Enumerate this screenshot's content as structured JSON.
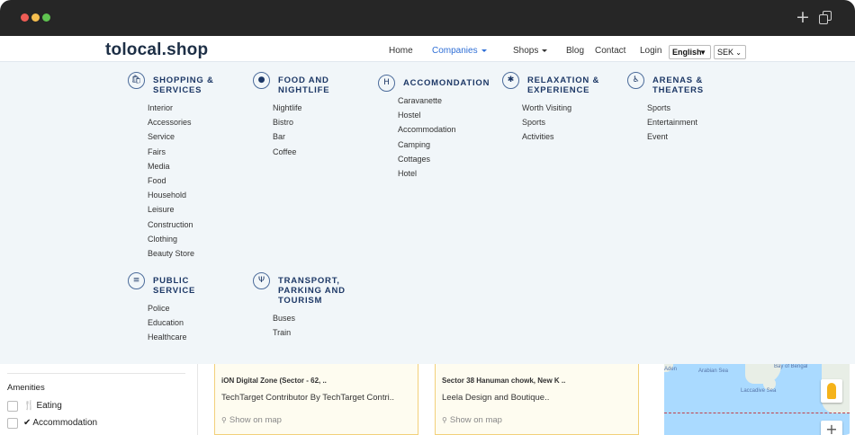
{
  "titlebar": {
    "plus_glyph": "+"
  },
  "header": {
    "logo": "tolocal.shop",
    "nav": {
      "home": "Home",
      "companies": "Companies",
      "shops": "Shops",
      "blog": "Blog",
      "contact": "Contact",
      "login": "Login"
    },
    "language": "English",
    "currency": "SEK"
  },
  "mega_menu": {
    "categories": [
      {
        "icon": "shopping-bag-icon",
        "icon_glyph": "🛍",
        "title": "SHOPPING & SERVICES",
        "title_lines": [
          "SHOPPING &",
          "SERVICES"
        ],
        "items": [
          "Interior",
          "Accessories",
          "Service",
          "Fairs",
          "Media",
          "Food",
          "Household",
          "Leisure",
          "Construction",
          "Clothing",
          "Beauty Store"
        ]
      },
      {
        "icon": "globe-icon",
        "icon_glyph": "●",
        "title": "FOOD AND NIGHTLIFE",
        "title_lines": [
          "FOOD AND",
          "NIGHTLIFE"
        ],
        "items": [
          "Nightlife",
          "Bistro",
          "Bar",
          "Coffee"
        ]
      },
      {
        "icon": "hotel-icon",
        "icon_glyph": "H",
        "title": "ACCOMONDATION",
        "title_lines": [
          "ACCOMONDATION"
        ],
        "items": [
          "Caravanette",
          "Hostel",
          "Accommodation",
          "Camping",
          "Cottages",
          "Hotel"
        ]
      },
      {
        "icon": "bug-icon",
        "icon_glyph": "✱",
        "title": "RELAXATION & EXPERIENCE",
        "title_lines": [
          "RELAXATION &",
          "EXPERIENCE"
        ],
        "items": [
          "Worth Visiting",
          "Sports",
          "Activities"
        ]
      },
      {
        "icon": "wheelchair-icon",
        "icon_glyph": "♿",
        "title": "ARENAS & THEATERS",
        "title_lines": [
          "ARENAS &",
          "THEATERS"
        ],
        "items": [
          "Sports",
          "Entertainment",
          "Event"
        ]
      },
      {
        "icon": "building-icon",
        "icon_glyph": "≡",
        "title": "PUBLIC SERVICE",
        "title_lines": [
          "PUBLIC",
          "SERVICE"
        ],
        "items": [
          "Police",
          "Education",
          "Healthcare"
        ]
      },
      {
        "icon": "utensils-icon",
        "icon_glyph": "Ψ",
        "title": "TRANSPORT, PARKING AND TOURISM",
        "title_lines": [
          "TRANSPORT,",
          "PARKING AND",
          "TOURISM"
        ],
        "items": [
          "Buses",
          "Train"
        ]
      }
    ]
  },
  "sidebar": {
    "amenities_title": "Amenities",
    "amenities": [
      {
        "label": "Eating",
        "icon": "utensils-icon",
        "icon_glyph": "🍴"
      },
      {
        "label": "Accommodation",
        "icon": "check-icon",
        "icon_glyph": "✔"
      }
    ]
  },
  "listings": [
    {
      "address": "iON Digital Zone (Sector - 62, ..",
      "name": "TechTarget Contributor By TechTarget Contri..",
      "map_link": "Show on map"
    },
    {
      "address": "Sector 38 Hanuman chowk, New K ..",
      "name": "Leela Design and Boutique..",
      "map_link": "Show on map"
    }
  ],
  "map": {
    "labels": [
      "Aden",
      "Arabian Sea",
      "Bay of Bengal",
      "Laccadive Sea"
    ],
    "zoom_in": "+"
  },
  "colors": {
    "accent": "#2f6fd6",
    "category_title": "#1d3866",
    "menu_bg": "#f1f6f9",
    "card_border": "#f2d07a",
    "titlebar": "#262626"
  }
}
